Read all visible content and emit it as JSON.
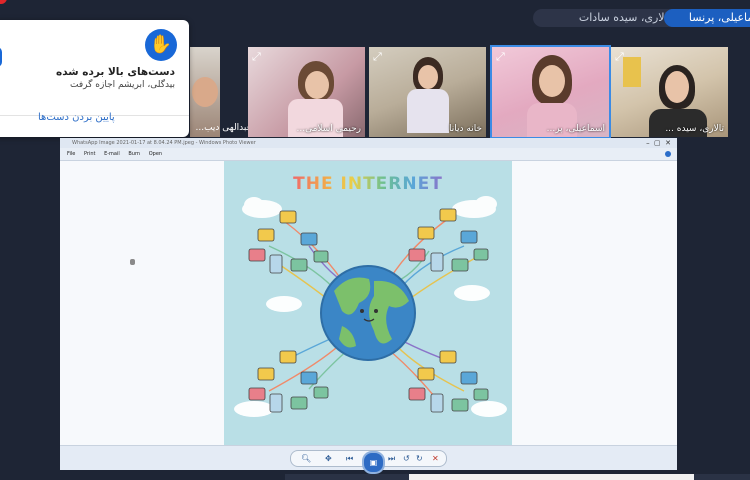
{
  "participants_bar": {
    "chip_main": "تالاری، سیده سادات",
    "chip_active": "اسماعیلی، پرنسا"
  },
  "video_tiles": [
    {
      "name": "عبدالهی دیب...",
      "expand_icon": "expand-icon"
    },
    {
      "name": "رحیمی اسلامی...",
      "expand_icon": "expand-icon"
    },
    {
      "name": "خانه دیانا",
      "expand_icon": "expand-icon"
    },
    {
      "name": "اسماعیلی، پر...",
      "expand_icon": "expand-icon"
    },
    {
      "name": "تالاری، سیده ...",
      "expand_icon": "expand-icon"
    }
  ],
  "notification": {
    "title": "دست‌های بالا برده شده",
    "subtitle": "بیدگلی، ابریشم اجازه گرفت",
    "action": "پایین بردن دست‌ها",
    "icon": "raised-hand-icon"
  },
  "viewer": {
    "window_title": "WhatsApp Image 2021-01-17 at 8.04.24 PM.jpeg - Windows Photo Viewer",
    "menu": [
      "File",
      "Print",
      "E-mail",
      "Burn",
      "Open"
    ],
    "poster_title": "THE INTERNET",
    "accent": "#2d6bc4"
  },
  "colors": {
    "background": "#1e2535",
    "active_chip": "#1c5fc0",
    "highlight_border": "#3b8be5"
  }
}
